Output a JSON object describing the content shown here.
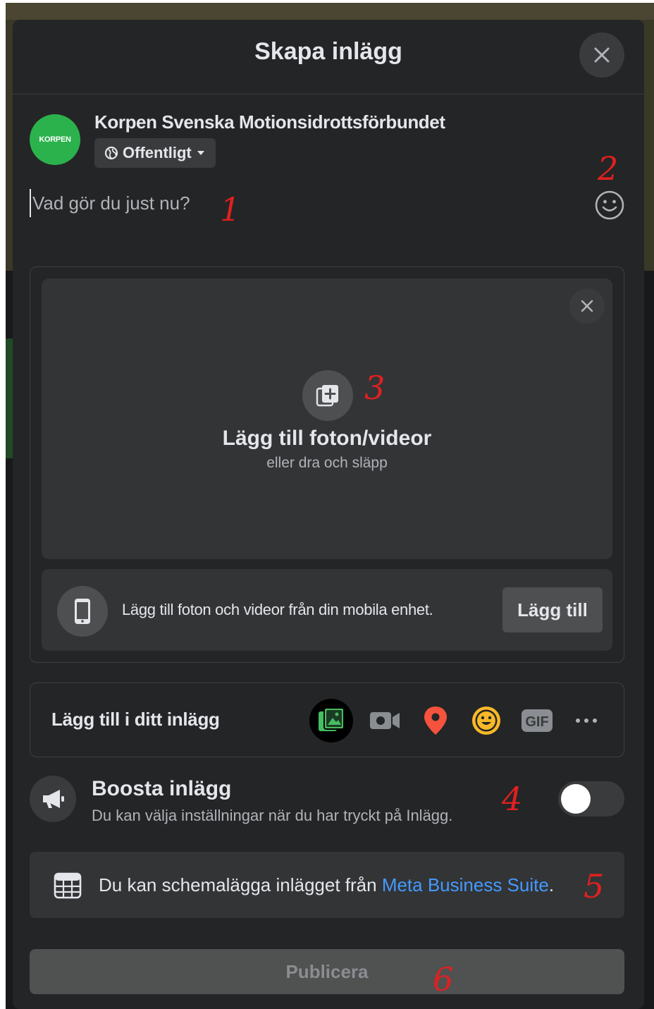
{
  "dialog": {
    "title": "Skapa inlägg",
    "close_icon": "close-icon"
  },
  "author": {
    "avatar_text": "KORPEN",
    "name": "Korpen Svenska Motionsidrottsförbundet",
    "privacy_label": "Offentligt"
  },
  "composer": {
    "placeholder": "Vad gör du just nu?"
  },
  "media": {
    "title": "Lägg till foton/videor",
    "subtitle": "eller dra och släpp",
    "mobile_text": "Lägg till foton och videor från din mobila enhet.",
    "mobile_button": "Lägg till"
  },
  "add_to_post": {
    "label": "Lägg till i ditt inlägg",
    "items": [
      {
        "name": "photo-video-icon",
        "color": "#45bd62"
      },
      {
        "name": "video-camera-icon",
        "color": "#8a8d91"
      },
      {
        "name": "location-pin-icon",
        "color": "#f5533d"
      },
      {
        "name": "smiley-feeling-icon",
        "color": "#f7b928"
      },
      {
        "name": "gif-icon",
        "color": "#8a8d91"
      },
      {
        "name": "more-icon",
        "color": "#b0b3b8"
      }
    ]
  },
  "boost": {
    "title": "Boosta inlägg",
    "description": "Du kan välja inställningar när du har tryckt på Inlägg.",
    "toggle_on": false
  },
  "schedule": {
    "text": "Du kan schemalägga inlägget från ",
    "link": "Meta Business Suite",
    "suffix": "."
  },
  "publish": {
    "label": "Publicera"
  },
  "annotations": [
    "1",
    "2",
    "3",
    "4",
    "5",
    "6"
  ],
  "colors": {
    "modal_bg": "#242526",
    "card_bg": "#323436",
    "link": "#4599ff",
    "annotation": "#e02020",
    "avatar": "#2bb24c"
  }
}
